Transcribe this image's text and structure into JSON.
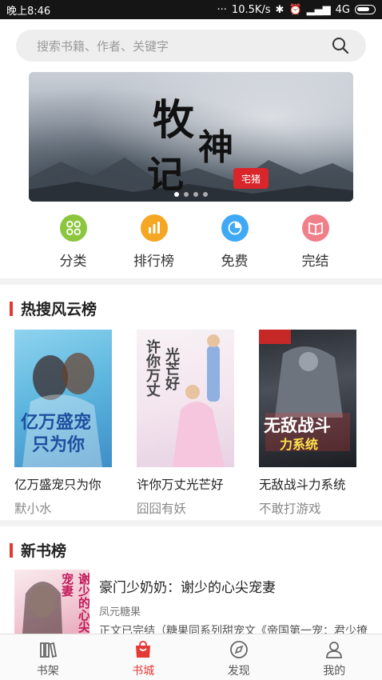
{
  "status_bar": {
    "time": "晚上8:46",
    "speed": "10.5K/s",
    "network": "4G"
  },
  "search": {
    "placeholder": "搜索书籍、作者、关键字"
  },
  "banner": {
    "title_chars": [
      "牧",
      "神",
      "记"
    ],
    "seal": "宅猪",
    "slide_count": 4,
    "active_slide": 1
  },
  "quick_links": [
    {
      "label": "分类",
      "icon": "grid-icon",
      "color": "#8cc63f"
    },
    {
      "label": "排行榜",
      "icon": "ranking-bars-icon",
      "color": "#f5a623"
    },
    {
      "label": "免费",
      "icon": "free-pie-icon",
      "color": "#3fa9f5"
    },
    {
      "label": "完结",
      "icon": "book-open-icon",
      "color": "#f07f8a"
    }
  ],
  "hot_section": {
    "title": "热搜风云榜",
    "books": [
      {
        "title": "亿万盛宠只为你",
        "author": "默小水",
        "cover_text": [
          "亿万盛宠",
          "只为你"
        ]
      },
      {
        "title": "许你万丈光芒好",
        "author": "囧囧有妖",
        "cover_text": [
          "许你万丈",
          "光芒好"
        ]
      },
      {
        "title": "无敌战斗力系统",
        "author": "不敢打游戏",
        "cover_text": [
          "无敌战斗",
          "力系统"
        ]
      }
    ]
  },
  "new_section": {
    "title": "新书榜",
    "books": [
      {
        "title": "豪门少奶奶：谢少的心尖宠妻",
        "author": "凤元糖果",
        "desc": "正文已完结（糖果同系列甜宠文《帝国第一宠：君少撩",
        "cover_text": "谢少的心尖宠妻"
      }
    ]
  },
  "tabs": [
    {
      "label": "书架",
      "icon": "bookshelf-icon",
      "active": false
    },
    {
      "label": "书城",
      "icon": "bookstore-bag-icon",
      "active": true
    },
    {
      "label": "发现",
      "icon": "compass-icon",
      "active": false
    },
    {
      "label": "我的",
      "icon": "profile-icon",
      "active": false
    }
  ],
  "colors": {
    "accent": "#e53935",
    "section_bg": "#f2f2f2"
  }
}
